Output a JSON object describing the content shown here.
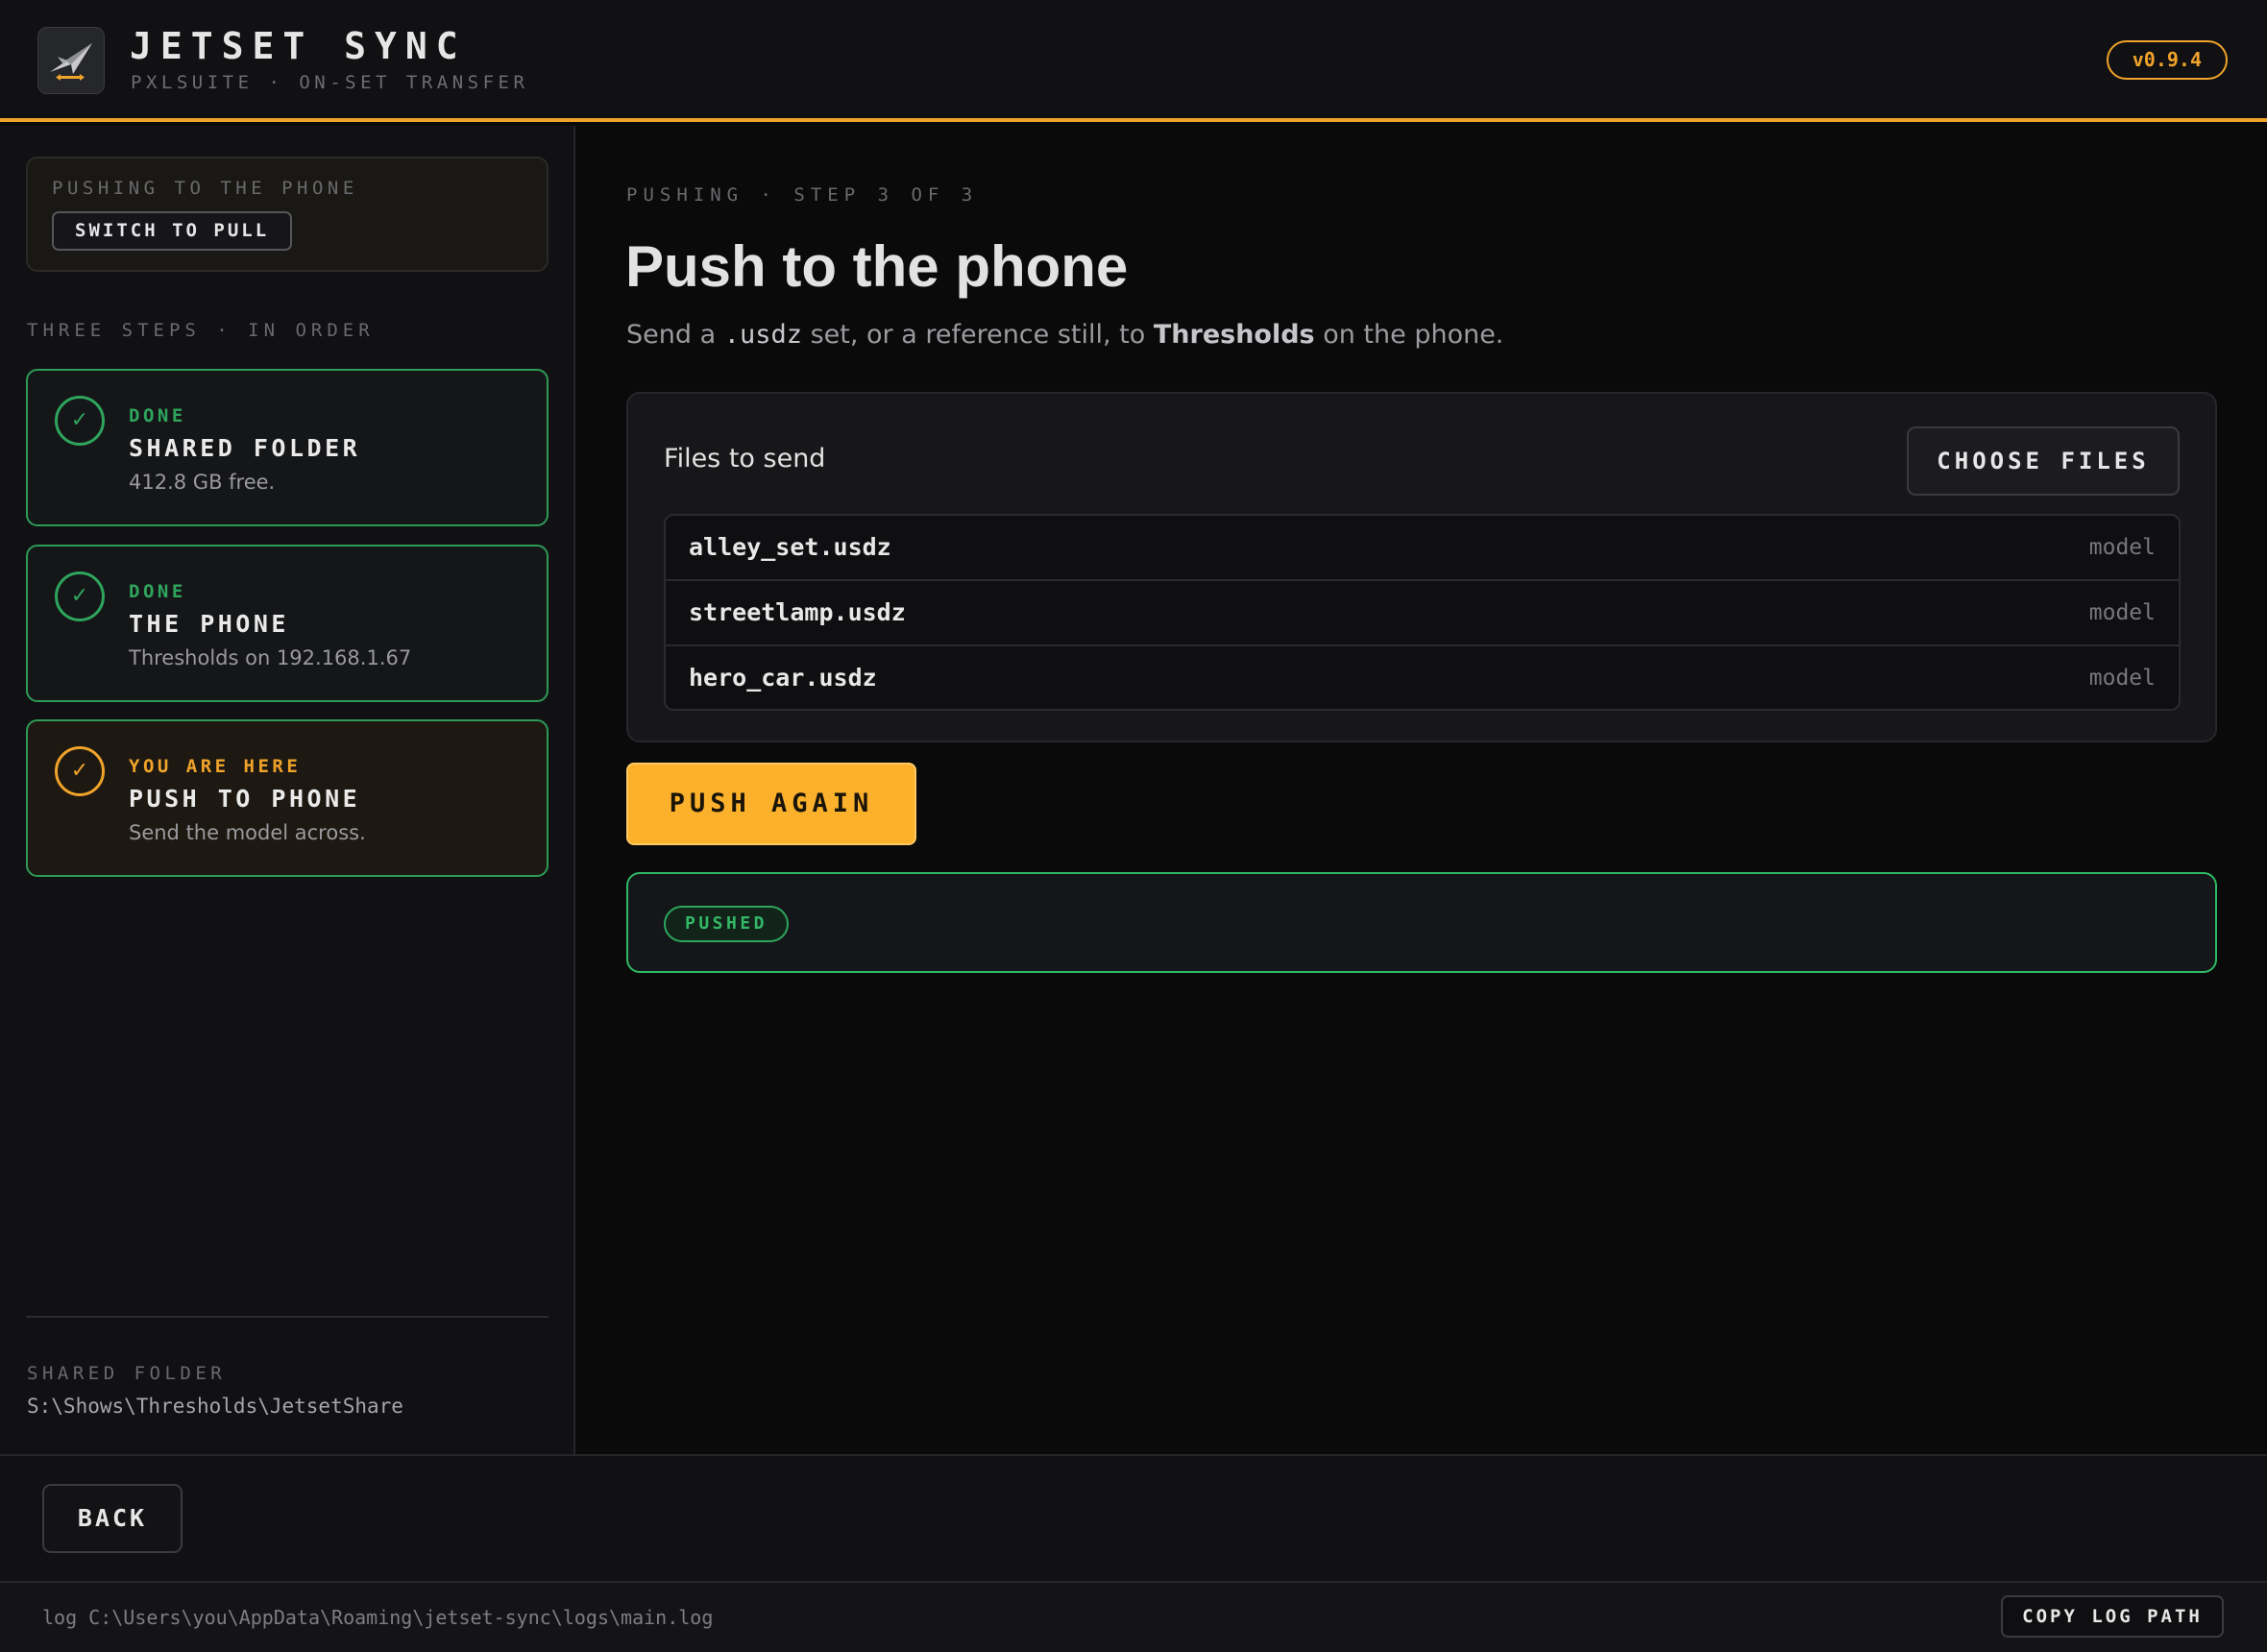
{
  "header": {
    "title": "JETSET SYNC",
    "subtitle": "PXLSUITE · ON-SET TRANSFER",
    "version": "v0.9.4"
  },
  "sidebar": {
    "mode_label": "PUSHING TO THE PHONE",
    "switch_label": "SWITCH TO PULL",
    "steps_heading": "THREE STEPS · IN ORDER",
    "steps": [
      {
        "status": "DONE",
        "title": "SHARED FOLDER",
        "desc": "412.8 GB free.",
        "state": "done"
      },
      {
        "status": "DONE",
        "title": "THE PHONE",
        "desc": "Thresholds on 192.168.1.67",
        "state": "done"
      },
      {
        "status": "YOU ARE HERE",
        "title": "PUSH TO PHONE",
        "desc": "Send the model across.",
        "state": "current"
      }
    ],
    "check_glyph": "✓",
    "folder_label": "SHARED FOLDER",
    "folder_path": "S:\\Shows\\Thresholds\\JetsetShare"
  },
  "main": {
    "eyebrow": "PUSHING · STEP 3 OF 3",
    "title": "Push to the phone",
    "subtitle_pre": "Send a ",
    "subtitle_code": ".usdz",
    "subtitle_mid": " set, or a reference still, to ",
    "subtitle_bold": "Thresholds",
    "subtitle_post": " on the phone.",
    "files_heading": "Files to send",
    "choose_label": "CHOOSE FILES",
    "files": [
      {
        "name": "alley_set.usdz",
        "kind": "model"
      },
      {
        "name": "streetlamp.usdz",
        "kind": "model"
      },
      {
        "name": "hero_car.usdz",
        "kind": "model"
      }
    ],
    "push_label": "PUSH AGAIN",
    "status_badge": "PUSHED"
  },
  "footer": {
    "back_label": "BACK",
    "log_path": "log C:\\Users\\you\\AppData\\Roaming\\jetset-sync\\logs\\main.log",
    "copy_log_label": "COPY LOG PATH"
  },
  "colors": {
    "accent": "#f0a32a",
    "success": "#2ea55c",
    "background": "#0a0a0b"
  },
  "icons": {
    "logo": "jet-plane-icon",
    "step_check": "check-icon"
  }
}
